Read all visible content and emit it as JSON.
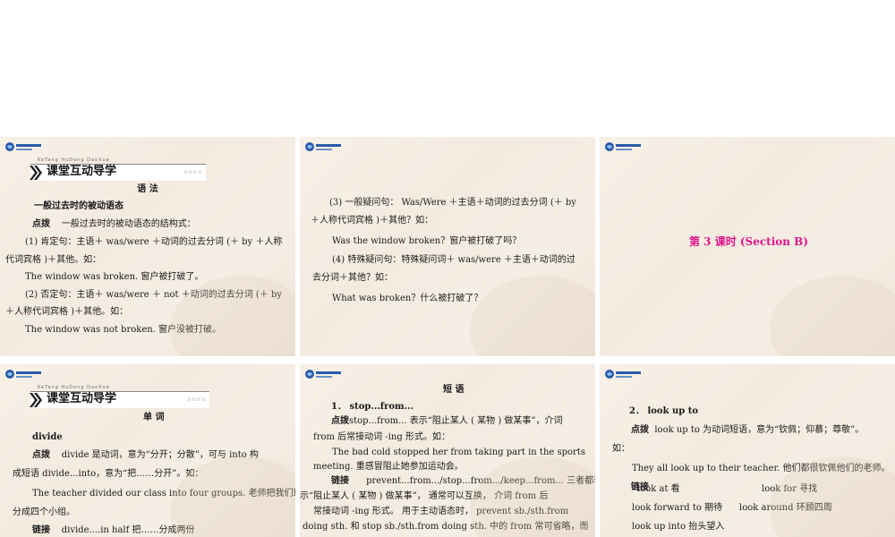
{
  "brand": {
    "logo_text": "Book",
    "logo_sub": "学习"
  },
  "banner": {
    "sub": "KeTang HuDong DaoXue",
    "title": "课堂互动导学",
    "stars": "☆☆☆☆"
  },
  "s1": {
    "heading": "语 法",
    "topic": "一般过去时的被动语态",
    "tip_tag": "点拨",
    "tip": "一般过去时的被动语态的结构式：",
    "l1": "(1) 肯定句：主语＋ was/were ＋动词的过去分词 (＋ by ＋人称",
    "l1b": "代词宾格 )＋其他。如：",
    "e1": "The window was broken. 窗户被打破了。",
    "l2": "(2) 否定句：主语＋ was/were ＋ not ＋动词的过去分词 (＋ by",
    "l2b": "＋人称代词宾格 )＋其他。如：",
    "e2": "The window was not broken. 窗户没被打破。"
  },
  "s2": {
    "l3": "(3) 一般疑问句： Was/Were ＋主语＋动词的过去分词 (＋ by",
    "l3b": "＋人称代词宾格 )＋其他？如：",
    "e3": "Was the window broken？窗户被打破了吗？",
    "l4": "(4) 特殊疑问句：特殊疑问词＋ was/were ＋主语＋动词的过",
    "l4b": "去分词＋其他？如：",
    "e4": "What was broken？什么被打破了？"
  },
  "s3": {
    "title": "第 3 课时 (Section B)"
  },
  "s4": {
    "heading": "单 词",
    "word": "divide",
    "tip_tag": "点拨",
    "tip": "divide 是动词，意为“分开；分散”，可与 into 构",
    "tip_b": "成短语 divide...into，意为“把……分开”。如：",
    "ex": "The teacher divided our class into four groups. 老师把我们班",
    "ex_b": "分成四个小组。",
    "link_tag": "链接",
    "link": "divide....in half 把……分成两份"
  },
  "s5": {
    "heading": "短 语",
    "item": "1． stop...from...",
    "tip_tag": "点拨",
    "tip": "stop...from... 表示“阻止某人 ( 某物 ) 做某事”，介词",
    "tip_b": "from 后常接动词 -ing 形式。如：",
    "ex": "The bad cold stopped her from taking part in the sports",
    "ex_b": "meeting. 重感冒阻止她参加运动会。",
    "link_tag": "链接",
    "link": "prevent...from.../stop...from.../keep...from... 三者都表",
    "link_b": "示“阻止某人 ( 某物 ) 做某事”， 通常可以互换， 介词 from 后",
    "link_c": "常接动词 -ing 形式。 用于主动语态时， prevent sb./sth.from",
    "link_d": "doing sth. 和 stop sb./sth.from doing sth. 中的 from 常可省略，而"
  },
  "s6": {
    "item": "2． look up to",
    "tip_tag": "点拨",
    "tip": "look up to 为动词短语，意为“钦佩；仰慕；尊敬”。",
    "tip_b": "如：",
    "ex": "They all look up to their teacher. 他们都很钦佩他们的老师。",
    "link_tag": "链接",
    "p1": "look at 看",
    "p2": "look for 寻找",
    "p3": "look forward to 期待",
    "p4": "look around 环顾四周",
    "p5": "look up into 抬头望入"
  }
}
